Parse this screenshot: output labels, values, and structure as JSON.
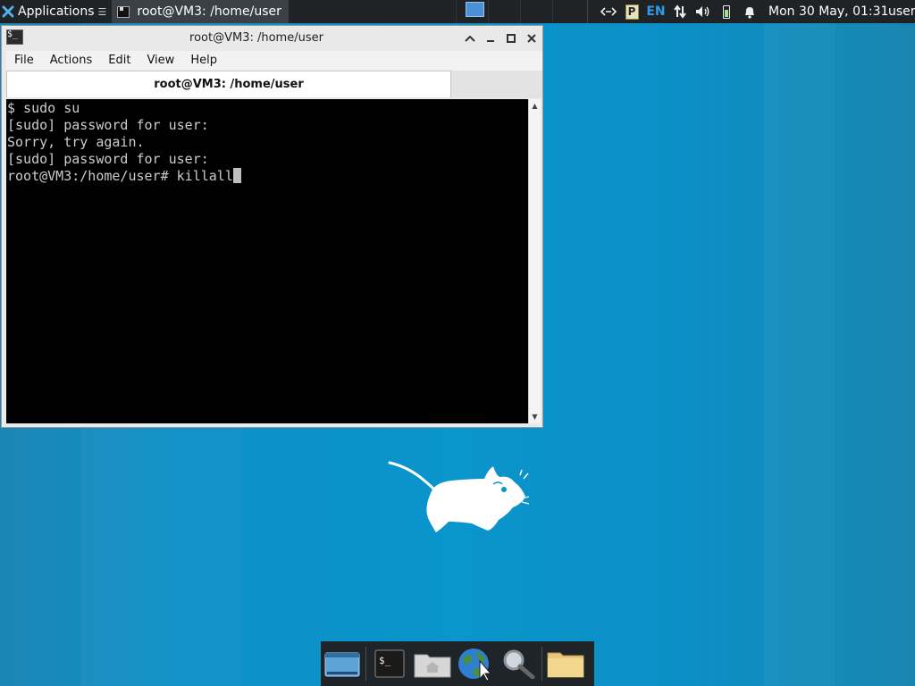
{
  "top_panel": {
    "applications_label": "Applications",
    "task_title": "root@VM3: /home/user",
    "keyboard_layout": "EN",
    "clipboard_letter": "P",
    "clock": "Mon 30 May, 01:31",
    "user": "user"
  },
  "window": {
    "title": "root@VM3: /home/user",
    "menu": [
      "File",
      "Actions",
      "Edit",
      "View",
      "Help"
    ],
    "tab_label": "root@VM3: /home/user"
  },
  "terminal": {
    "lines": [
      "$ sudo su",
      "[sudo] password for user:",
      "Sorry, try again.",
      "[sudo] password for user:"
    ],
    "prompt": "root@VM3:/home/user# ",
    "current_input": "killall"
  },
  "dock": {
    "items": [
      "show-desktop-icon",
      "terminal-icon",
      "home-folder-icon",
      "web-browser-icon",
      "search-icon",
      "file-manager-icon"
    ]
  },
  "colors": {
    "desktop": "#0a95cc",
    "panel": "#1f2326",
    "terminal_bg": "#000000",
    "terminal_fg": "#cccccc",
    "keyboard_accent": "#2f9be8"
  }
}
